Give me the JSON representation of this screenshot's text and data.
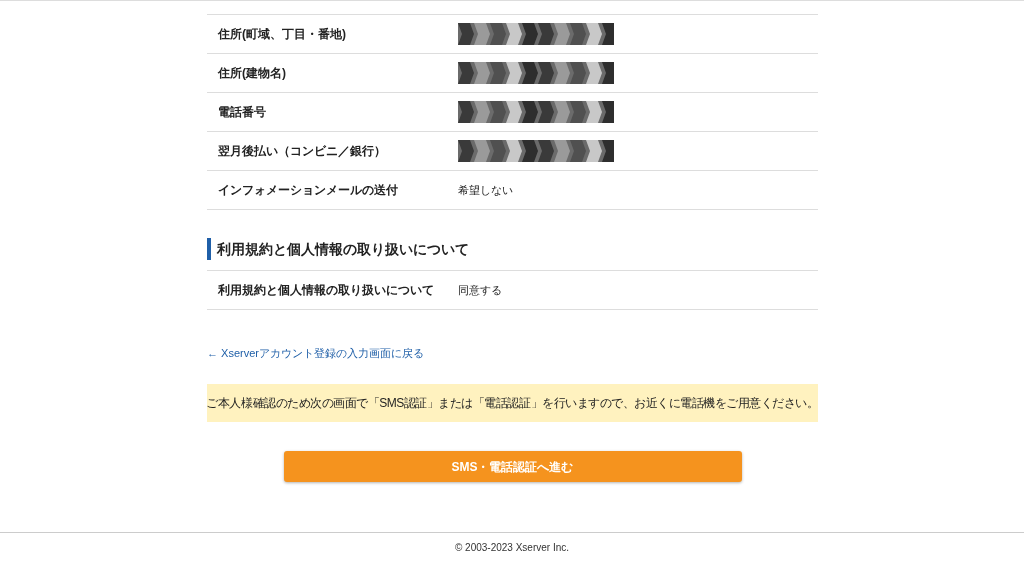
{
  "rows": [
    {
      "label": "住所(町域、丁目・番地)",
      "kind": "redacted"
    },
    {
      "label": "住所(建物名)",
      "kind": "redacted"
    },
    {
      "label": "電話番号",
      "kind": "redacted"
    },
    {
      "label": "翌月後払い（コンビニ／銀行）",
      "kind": "redacted"
    },
    {
      "label": "インフォメーションメールの送付",
      "kind": "text",
      "value": "希望しない"
    }
  ],
  "section": {
    "heading": "利用規約と個人情報の取り扱いについて",
    "rows": [
      {
        "label": "利用規約と個人情報の取り扱いについて",
        "kind": "text",
        "value": "同意する"
      }
    ]
  },
  "back_link": "← Xserverアカウント登録の入力画面に戻る",
  "notice": "ご本人様確認のため次の画面で「SMS認証」または「電話認証」を行いますので、お近くに電話機をご用意ください。",
  "submit_button": "SMS・電話認証へ進む",
  "footer": "© 2003-2023 Xserver Inc."
}
